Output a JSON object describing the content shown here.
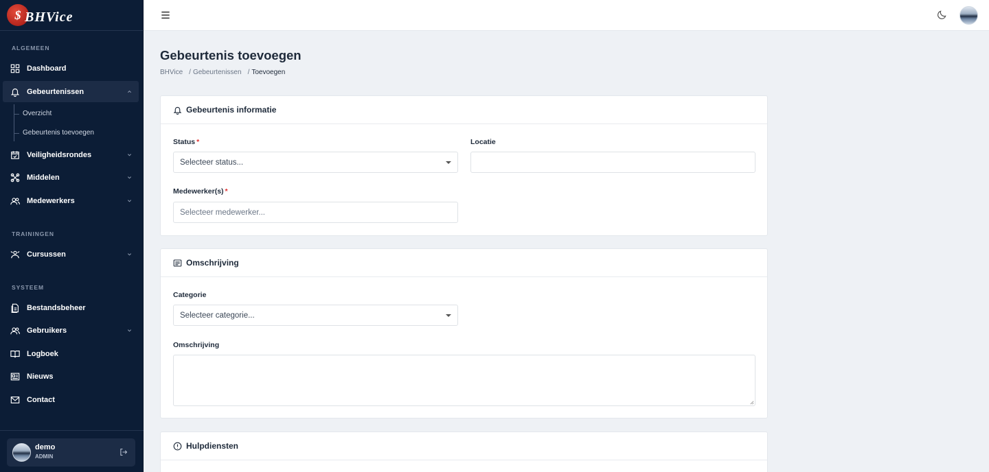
{
  "brand": {
    "logo_text": "BHVice",
    "logo_mark": "$"
  },
  "sidebar": {
    "sections": {
      "general": "ALGEMEEN",
      "trainings": "TRAININGEN",
      "system": "SYSTEEM"
    },
    "items": [
      {
        "label": "Dashboard",
        "icon": "grid-icon"
      },
      {
        "label": "Gebeurtenissen",
        "icon": "bell-icon",
        "expanded": true
      },
      {
        "label": "Veiligheidsrondes",
        "icon": "calendar-check-icon"
      },
      {
        "label": "Middelen",
        "icon": "tools-icon"
      },
      {
        "label": "Medewerkers",
        "icon": "users-icon"
      },
      {
        "label": "Cursussen",
        "icon": "presentation-icon"
      },
      {
        "label": "Bestandsbeheer",
        "icon": "file-icon"
      },
      {
        "label": "Gebruikers",
        "icon": "users-icon"
      },
      {
        "label": "Logboek",
        "icon": "book-icon"
      },
      {
        "label": "Nieuws",
        "icon": "news-icon"
      },
      {
        "label": "Contact",
        "icon": "mail-icon"
      }
    ],
    "subitems": [
      "Overzicht",
      "Gebeurtenis toevoegen"
    ]
  },
  "user": {
    "name": "demo",
    "role": "ADMIN"
  },
  "page": {
    "title": "Gebeurtenis toevoegen",
    "breadcrumb": [
      "BHVice",
      "Gebeurtenissen",
      "Toevoegen"
    ]
  },
  "cards": {
    "info": {
      "title": "Gebeurtenis informatie",
      "status_label": "Status",
      "status_placeholder": "Selecteer status...",
      "locatie_label": "Locatie",
      "locatie_value": "",
      "medewerkers_label": "Medewerker(s)",
      "medewerkers_placeholder": "Selecteer medewerker..."
    },
    "description": {
      "title": "Omschrijving",
      "categorie_label": "Categorie",
      "categorie_placeholder": "Selecteer categorie...",
      "omschrijving_label": "Omschrijving",
      "omschrijving_value": ""
    },
    "services": {
      "title": "Hulpdiensten"
    }
  },
  "colors": {
    "sidebar_bg": "#0c1d36",
    "active_item_bg": "#1c2c46",
    "required": "#e03131",
    "page_bg": "#eef1f5"
  }
}
